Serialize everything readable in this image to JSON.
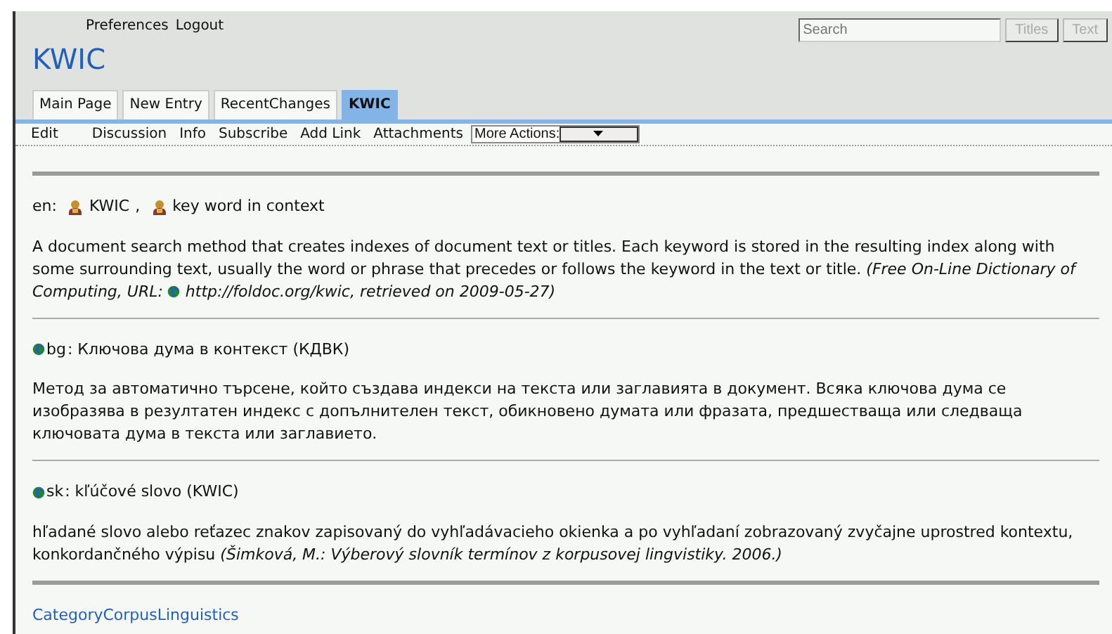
{
  "user_links": [
    {
      "label": "Preferences"
    },
    {
      "label": "Logout"
    }
  ],
  "page_title": "KWIC",
  "search": {
    "placeholder": "Search",
    "buttons": [
      {
        "label": "Titles",
        "disabled": true
      },
      {
        "label": "Text",
        "disabled": true
      }
    ]
  },
  "nav_tabs": [
    {
      "label": "Main Page",
      "selected": false
    },
    {
      "label": "New Entry",
      "selected": false
    },
    {
      "label": "RecentChanges",
      "selected": false
    },
    {
      "label": "KWIC",
      "selected": true
    }
  ],
  "actions": [
    "Edit",
    "Discussion",
    "Info",
    "Subscribe",
    "Add Link",
    "Attachments"
  ],
  "more_actions": {
    "value": "More Actions:"
  },
  "entries": [
    {
      "kind": "terms",
      "label": "en:",
      "terms": [
        "KWIC",
        "key word in context"
      ],
      "separator": ",",
      "definition": "A document search method that creates indexes of document text or titles. Each keyword is stored in the resulting index along with some surrounding text, usually the word or phrase that precedes or follows the keyword in the text or title.",
      "citation": {
        "before": "(Free On-Line Dictionary of Computing, URL:",
        "link": "http://foldoc.org/kwic",
        "after": ", retrieved on 2009-05-27)"
      }
    },
    {
      "kind": "language",
      "lang": "bg",
      "rest": ": Ключова дума в контекст (КДВК)",
      "definition": "Метод за автоматично търсене, който създава индекси на текста или заглавията в документ. Всяка ключова дума се изобразява в резултатен индекс с допълнителен текст, обикновено думата или фразата, предшестваща или следваща ключовата дума в текста или заглавието."
    },
    {
      "kind": "language",
      "lang": "sk",
      "rest": ": kľúčové slovo (KWIC)",
      "definition": "hľadané slovo alebo reťazec znakov zapisovaný do vyhľadávacieho okienka a po vyhľadaní zobrazovaný zvyčajne uprostred kontextu, konkordančného výpisu",
      "citation": {
        "before": "(Šimková, M.: Výberový slovník termínov z korpusovej lingvistiky. 2006.)"
      }
    }
  ],
  "category": "CategoryCorpusLinguistics"
}
